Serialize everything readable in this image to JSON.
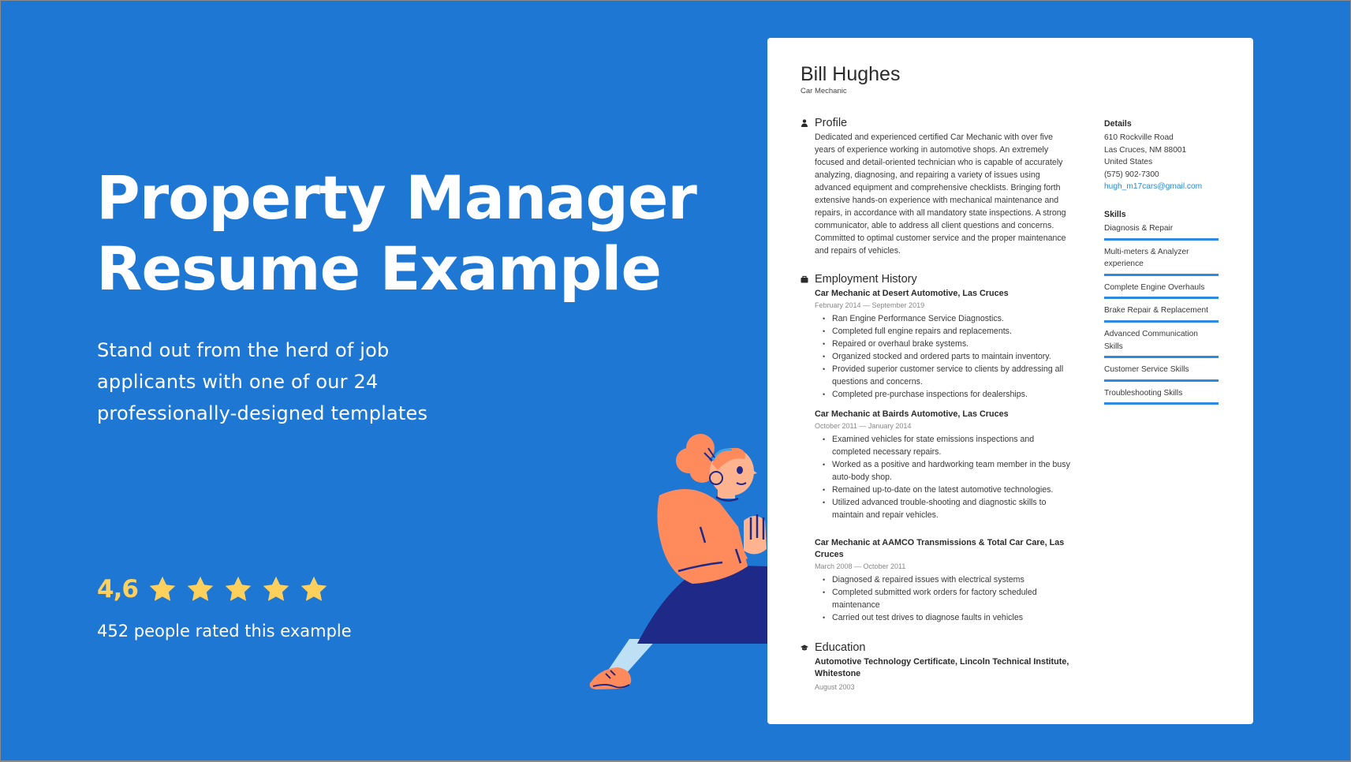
{
  "hero": {
    "title_line1": "Property Manager",
    "title_line2": "Resume Example",
    "subtitle_line1": "Stand out from the herd of job",
    "subtitle_line2": "applicants with one of our 24",
    "subtitle_line3": "professionally-designed templates"
  },
  "rating": {
    "value": "4,6",
    "stars": 5,
    "count_text": "452 people rated this example",
    "star_color": "#ffd15c"
  },
  "colors": {
    "background": "#1f77d4",
    "accent": "#2d8ae0",
    "email": "#2b8ad6"
  },
  "resume": {
    "name": "Bill Hughes",
    "role": "Car Mechanic",
    "profile": {
      "heading": "Profile",
      "icon": "person-icon",
      "text": "Dedicated and experienced certified Car Mechanic with over five years of experience working in automotive shops. An extremely focused and detail-oriented technician who is capable of accurately analyzing, diagnosing, and repairing a variety of issues using advanced equipment and comprehensive checklists. Bringing forth extensive hands-on experience with mechanical maintenance and repairs, in accordance with all mandatory state inspections. A strong communicator, able to address all client questions and concerns. Committed to optimal customer service and the proper maintenance and repairs of vehicles."
    },
    "employment": {
      "heading": "Employment History",
      "icon": "briefcase-icon",
      "jobs": [
        {
          "title": "Car Mechanic at Desert Automotive, Las Cruces",
          "dates": "February 2014 — September 2019",
          "bullets": [
            "Ran Engine Performance Service Diagnostics.",
            "Completed full engine repairs and replacements.",
            "Repaired or overhaul brake systems.",
            "Organized stocked and ordered parts to maintain inventory.",
            "Provided superior customer service to clients by addressing all questions and concerns.",
            "Completed pre-purchase inspections for dealerships."
          ]
        },
        {
          "title": "Car Mechanic at Bairds Automotive, Las Cruces",
          "dates": "October 2011 — January 2014",
          "bullets": [
            "Examined vehicles for state emissions inspections and completed necessary repairs.",
            "Worked as a positive and hardworking team member in the busy auto-body shop.",
            "Remained up-to-date on the latest automotive technologies.",
            "Utilized advanced trouble-shooting and diagnostic skills to maintain and repair vehicles."
          ]
        },
        {
          "title": "Car Mechanic at AAMCO Transmissions & Total Car Care, Las Cruces",
          "dates": "March 2008 — October 2011",
          "bullets": [
            "Diagnosed & repaired issues with electrical systems",
            "Completed submitted work orders for factory scheduled maintenance",
            "Carried out test drives to diagnose faults in vehicles"
          ]
        }
      ]
    },
    "education": {
      "heading": "Education",
      "icon": "graduation-cap-icon",
      "degree": "Automotive Technology Certificate, Lincoln Technical Institute, Whitestone",
      "date": "August 2003"
    },
    "details": {
      "heading": "Details",
      "address1": "610 Rockville Road",
      "address2": "Las Cruces, NM 88001",
      "country": "United States",
      "phone": "(575) 902-7300",
      "email": "hugh_m17cars@gmail.com"
    },
    "skills": {
      "heading": "Skills",
      "items": [
        "Diagnosis & Repair",
        "Multi-meters & Analyzer experience",
        "Complete Engine Overhauls",
        "Brake Repair & Replacement",
        "Advanced Communication Skills",
        "Customer Service Skills",
        "Troubleshooting Skills"
      ]
    }
  }
}
